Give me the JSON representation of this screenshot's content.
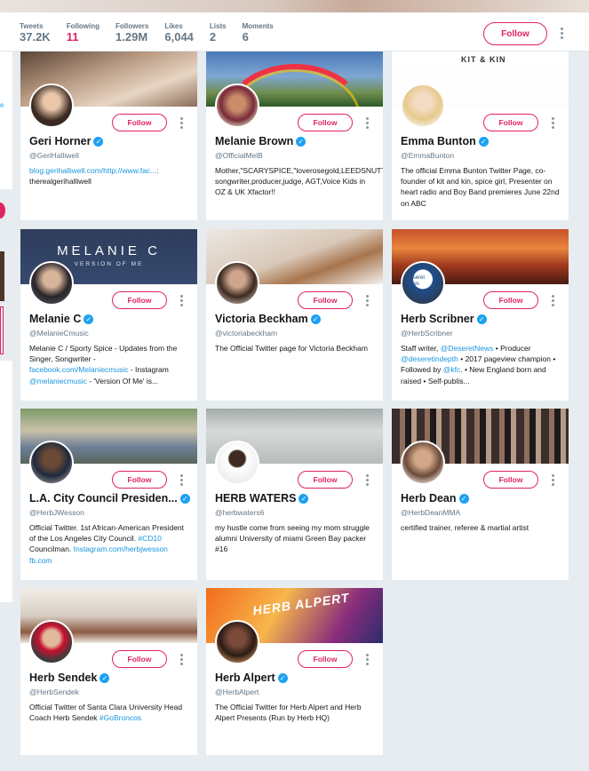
{
  "nav": {
    "stats": [
      {
        "label": "Tweets",
        "value": "37.2K"
      },
      {
        "label": "Following",
        "value": "11"
      },
      {
        "label": "Followers",
        "value": "1.29M"
      },
      {
        "label": "Likes",
        "value": "6,044"
      },
      {
        "label": "Lists",
        "value": "2"
      },
      {
        "label": "Moments",
        "value": "6"
      }
    ],
    "follow_label": "Follow"
  },
  "colors": {
    "accent": "#e0245e",
    "verified": "#1da1f2",
    "link": "#1b95e0"
  },
  "sidebar_sliver": {
    "text": "e"
  },
  "cards": [
    {
      "name": "Geri Horner",
      "handle": "@GeriHalliwell",
      "verified": true,
      "follow": "Follow",
      "bio": [
        {
          "t": "blog.gerihalliwell.com/http://www.fac...",
          "link": true
        },
        {
          "t": ": therealgerihalliwell",
          "link": false
        }
      ]
    },
    {
      "name": "Melanie Brown",
      "handle": "@OfficialMelB",
      "verified": true,
      "follow": "Follow",
      "bio": [
        {
          "t": "Mother,\"SCARYSPICE,\"loverosegold,LEEDSNUTTER,singer songwriter,producer,judge, AGT,Voice Kids in OZ & UK Xfactor!!",
          "link": false
        }
      ]
    },
    {
      "name": "Emma Bunton",
      "handle": "@EmmaBunton",
      "verified": true,
      "follow": "Follow",
      "banner_text": "KIT & KIN",
      "bio": [
        {
          "t": "The official Emma Bunton Twitter Page, co-founder of kit and kin, spice girl, Presenter on heart radio and Boy Band premieres June 22nd on ABC",
          "link": false
        }
      ]
    },
    {
      "name": "Melanie C",
      "handle": "@MelanieCmusic",
      "verified": true,
      "follow": "Follow",
      "banner_title": "MELANIE C",
      "banner_sub": "VERSION OF ME",
      "bio": [
        {
          "t": "Melanie C / Sporty Spice - Updates from the Singer, Songwriter - ",
          "link": false
        },
        {
          "t": "facebook.com/Melaniecmusic",
          "link": true
        },
        {
          "t": " - Instagram ",
          "link": false
        },
        {
          "t": "@melaniecmusic",
          "link": true
        },
        {
          "t": " - 'Version Of Me' is...",
          "link": false
        }
      ]
    },
    {
      "name": "Victoria Beckham",
      "handle": "@victoriabeckham",
      "verified": true,
      "follow": "Follow",
      "bio": [
        {
          "t": "The Official Twitter page for Victoria Beckham",
          "link": false
        }
      ]
    },
    {
      "name": "Herb Scribner",
      "handle": "@HerbScribner",
      "verified": true,
      "follow": "Follow",
      "avatar_text": "Deseret News",
      "bio": [
        {
          "t": "Staff writer, ",
          "link": false
        },
        {
          "t": "@DeseretNews",
          "link": true
        },
        {
          "t": " • Producer ",
          "link": false
        },
        {
          "t": "@deseretindepth",
          "link": true
        },
        {
          "t": " • 2017 pageview champion • Followed by ",
          "link": false
        },
        {
          "t": "@kfc",
          "link": true
        },
        {
          "t": ". • New England born and raised • Self-publis...",
          "link": false
        }
      ]
    },
    {
      "name": "L.A. City Council Presiden...",
      "handle": "@HerbJWesson",
      "verified": true,
      "follow": "Follow",
      "bio": [
        {
          "t": "Official Twitter. 1st African-American President of the Los Angeles City Council. ",
          "link": false
        },
        {
          "t": "#CD10",
          "link": true
        },
        {
          "t": " Councilman. ",
          "link": false
        },
        {
          "t": "Instagram.com/herbjwesson fb.com",
          "link": true
        }
      ]
    },
    {
      "name": "HERB WATERS",
      "handle": "@herbwaters6",
      "verified": true,
      "follow": "Follow",
      "bio": [
        {
          "t": "my hustle come from seeing my mom struggle alumni University of miami Green Bay packer #16",
          "link": false
        }
      ]
    },
    {
      "name": "Herb Dean",
      "handle": "@HerbDeanMMA",
      "verified": true,
      "follow": "Follow",
      "bio": [
        {
          "t": "certified trainer, referee & martial artist",
          "link": false
        }
      ]
    },
    {
      "name": "Herb Sendek",
      "handle": "@HerbSendek",
      "verified": true,
      "follow": "Follow",
      "bio": [
        {
          "t": "Official Twitter of Santa Clara University Head Coach Herb Sendek ",
          "link": false
        },
        {
          "t": "#GoBroncos",
          "link": true
        }
      ]
    },
    {
      "name": "Herb Alpert",
      "handle": "@HerbAlpert",
      "verified": true,
      "follow": "Follow",
      "banner_text": "HERB ALPERT",
      "bio": [
        {
          "t": "The Official Twitter for Herb Alpert and Herb Alpert Presents (Run by Herb HQ)",
          "link": false
        }
      ]
    }
  ]
}
